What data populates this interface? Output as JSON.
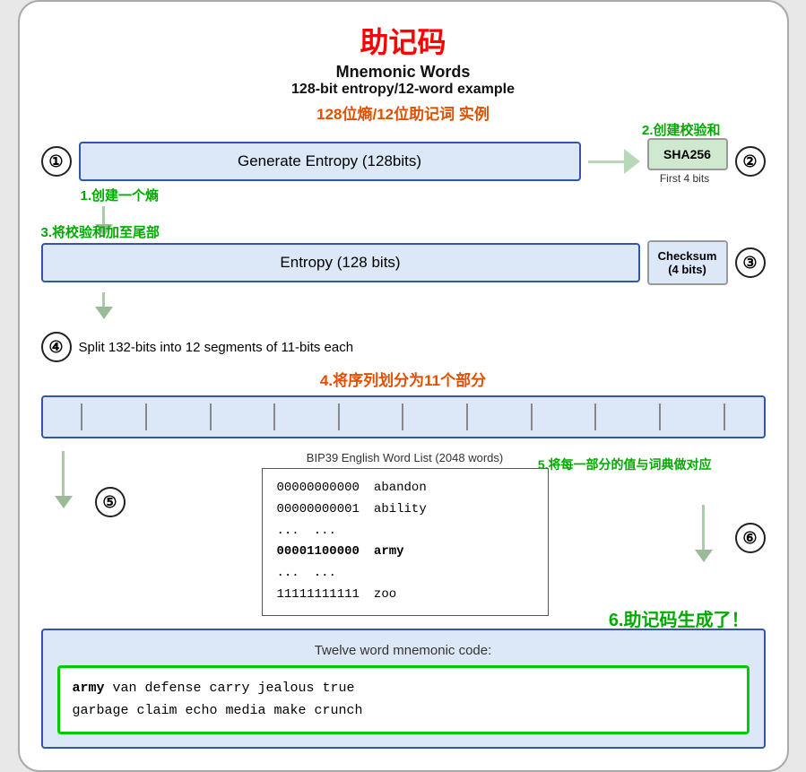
{
  "title": {
    "cn": "助记码",
    "en1": "Mnemonic Words",
    "en2": "128-bit entropy/12-word example",
    "cn2": "128位熵/12位助记词 实例"
  },
  "labels": {
    "label1": "1.创建一个熵",
    "label2": "2.创建校验和",
    "label3": "3.将校验和加至尾部",
    "label4": "4.将序列划分为11个部分",
    "label5": "5.将每一部分的值与词典做对应",
    "label6": "6.助记码生成了！"
  },
  "row1": {
    "step1": "①",
    "entropy_label": "Generate Entropy (128bits)",
    "sha_label": "SHA256",
    "first4": "First 4 bits",
    "step2": "②"
  },
  "row2": {
    "entropy_label": "Entropy (128 bits)",
    "checksum_label": "Checksum\n(4 bits)",
    "step3": "③"
  },
  "row3": {
    "split_desc": "Split 132-bits into 12 segments of 11-bits each"
  },
  "wordlist": {
    "title": "BIP39 English Word List (2048 words)",
    "step5": "⑤",
    "step6": "⑥",
    "rows": [
      {
        "binary": "00000000000",
        "word": "abandon"
      },
      {
        "binary": "00000000001",
        "word": "ability"
      },
      {
        "binary": "...",
        "word": "..."
      },
      {
        "binary": "00001100000",
        "word": "army"
      },
      {
        "binary": "...",
        "word": "..."
      },
      {
        "binary": "11111111111",
        "word": "zoo"
      }
    ]
  },
  "output": {
    "label": "Twelve word mnemonic code:",
    "mnemonic": "army van defense carry jealous true garbage claim echo media make crunch",
    "first_word": "army"
  }
}
